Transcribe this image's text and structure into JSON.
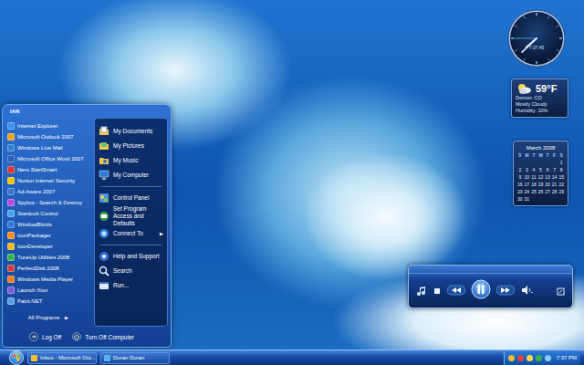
{
  "start_menu": {
    "user": "IAN",
    "pinned": [
      {
        "label": "Internet Explorer"
      },
      {
        "label": "Microsoft Outlook 2007"
      },
      {
        "label": "Windows Live Mail"
      },
      {
        "label": "Microsoft Office Word 2007"
      },
      {
        "label": "Nero StartSmart"
      },
      {
        "label": "Norton Internet Security"
      },
      {
        "label": "Ad-Aware 2007"
      },
      {
        "label": "Spybot - Search & Destroy"
      },
      {
        "label": "Stardock Control"
      },
      {
        "label": "WindowBlinds"
      },
      {
        "label": "IconPackager"
      },
      {
        "label": "IconDeveloper"
      },
      {
        "label": "TuneUp Utilities 2008"
      },
      {
        "label": "PerfectDisk 2008"
      },
      {
        "label": "Windows Media Player"
      },
      {
        "label": "Launch Xion"
      },
      {
        "label": "Paint.NET"
      }
    ],
    "all_programs": {
      "label": "All Programs",
      "arrow": "▶"
    },
    "places": [
      [
        {
          "label": "My Documents"
        },
        {
          "label": "My Pictures"
        },
        {
          "label": "My Music"
        },
        {
          "label": "My Computer"
        }
      ],
      [
        {
          "label": "Control Panel"
        },
        {
          "label": "Set Program Access and Defaults"
        },
        {
          "label": "Connect To",
          "arrow": "▶"
        }
      ],
      [
        {
          "label": "Help and Support"
        },
        {
          "label": "Search"
        },
        {
          "label": "Run..."
        }
      ]
    ],
    "log_off": "Log Off",
    "turn_off": "Turn Off Computer"
  },
  "clock": {
    "time": "7:37:45",
    "hour": 7,
    "minute": 37,
    "second": 45
  },
  "weather": {
    "temperature": "59°F",
    "location": "Denver, CO",
    "condition": "Mostly Cloudy",
    "humidity": "Humidity: 10%"
  },
  "calendar": {
    "title": "March 2008",
    "weekdays": [
      "S",
      "M",
      "T",
      "W",
      "T",
      "F",
      "S"
    ],
    "weeks": [
      [
        "1"
      ],
      [
        "2",
        "3",
        "4",
        "5",
        "6",
        "7",
        "8"
      ],
      [
        "9",
        "10",
        "11",
        "12",
        "13",
        "14",
        "15"
      ],
      [
        "16",
        "17",
        "18",
        "19",
        "20",
        "21",
        "22"
      ],
      [
        "23",
        "24",
        "25",
        "26",
        "27",
        "28",
        "29"
      ],
      [
        "30",
        "31"
      ]
    ]
  },
  "media_player": {
    "playing": true
  },
  "taskbar": {
    "tasks": [
      {
        "label": "Inbox - Microsoft Out...",
        "selected": false
      },
      {
        "label": "Duran Duran",
        "selected": false
      }
    ],
    "clock": "7:37 PM"
  }
}
